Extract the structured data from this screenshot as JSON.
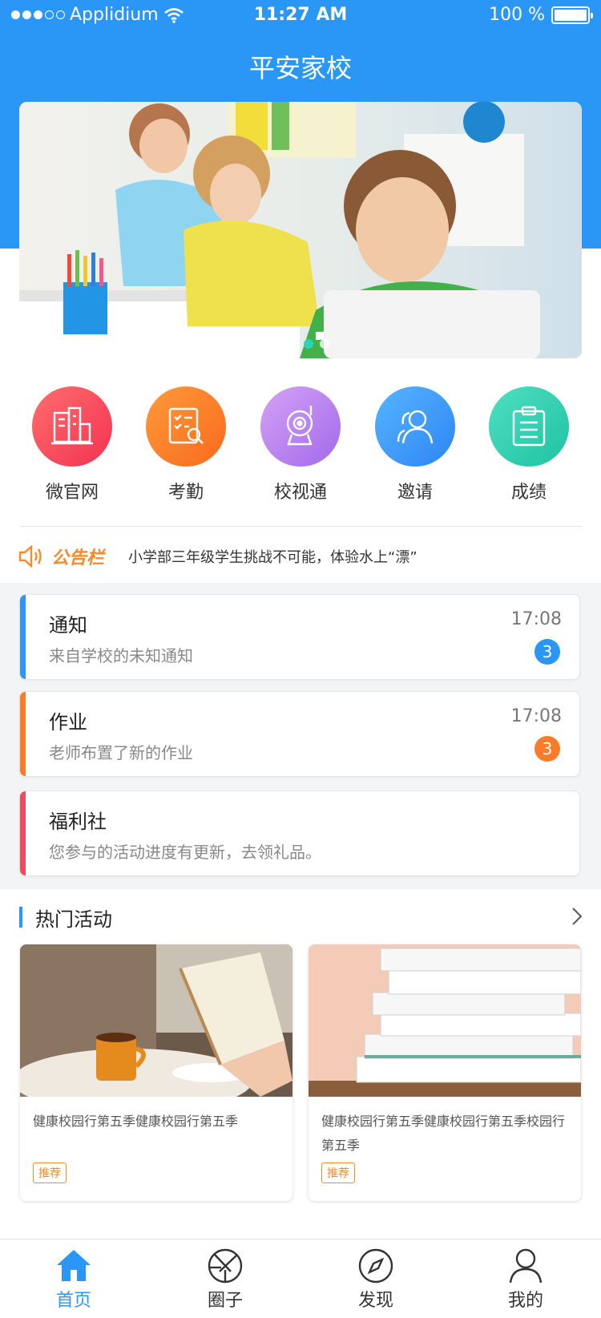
{
  "status_bar": {
    "carrier": "Applidium",
    "time": "11:27 AM",
    "battery": "100 %"
  },
  "header": {
    "title": "平安家校"
  },
  "banner": {
    "page_count": 4,
    "active_index": 2
  },
  "quick_nav": [
    {
      "label": "微官网",
      "icon": "building-icon",
      "color": "#f4485c"
    },
    {
      "label": "考勤",
      "icon": "checklist-icon",
      "color": "#fb7b28"
    },
    {
      "label": "校视通",
      "icon": "camera-icon",
      "color": "#b77ef0"
    },
    {
      "label": "邀请",
      "icon": "users-icon",
      "color": "#3a9cfb"
    },
    {
      "label": "成绩",
      "icon": "clipboard-icon",
      "color": "#2ccfb0"
    }
  ],
  "notice": {
    "tag": "公告栏",
    "text": "小学部三年级学生挑战不可能，体验水上“漂”"
  },
  "messages": [
    {
      "title": "通知",
      "subtitle": "来自学校的未知通知",
      "time": "17:08",
      "badge": "3",
      "color": "#2a97f7"
    },
    {
      "title": "作业",
      "subtitle": "老师布置了新的作业",
      "time": "17:08",
      "badge": "3",
      "color": "#fb7b28"
    },
    {
      "title": "福利社",
      "subtitle": "您参与的活动进度有更新，去领礼品。",
      "time": "",
      "badge": "",
      "color": "#f4485c"
    }
  ],
  "hot": {
    "title": "热门活动",
    "cards": [
      {
        "text": "健康校园行第五季健康校园行第五季",
        "tag": "推荐"
      },
      {
        "text": "健康校园行第五季健康校园行第五季校园行第五季",
        "tag": "推荐"
      }
    ]
  },
  "tabs": [
    {
      "label": "首页",
      "icon": "home-icon",
      "active": true
    },
    {
      "label": "圈子",
      "icon": "aperture-icon",
      "active": false
    },
    {
      "label": "发现",
      "icon": "compass-icon",
      "active": false
    },
    {
      "label": "我的",
      "icon": "person-icon",
      "active": false
    }
  ],
  "colors": {
    "primary": "#2a97f7",
    "accent": "#f88a2a",
    "tab_inactive": "#333333"
  }
}
